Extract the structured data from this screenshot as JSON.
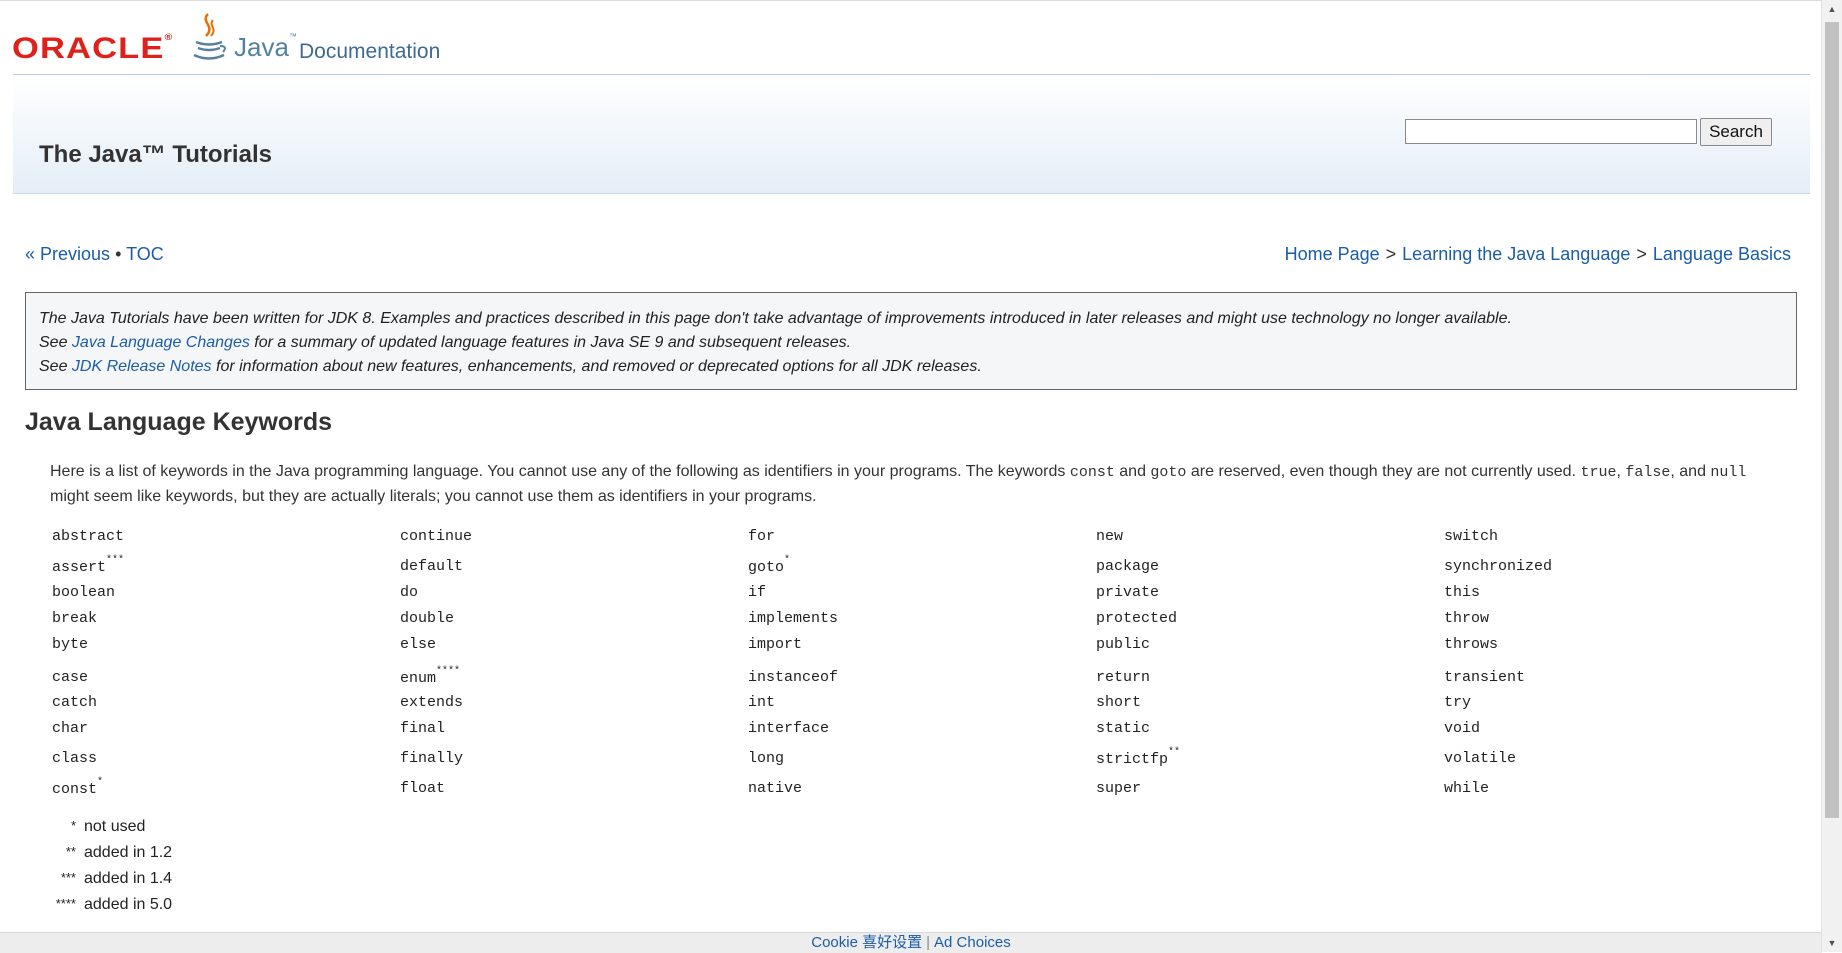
{
  "header": {
    "oracle_logo": "ORACLE",
    "java_logo": "Java",
    "doc_label": "Documentation"
  },
  "banner": {
    "title": "The Java™ Tutorials",
    "search_placeholder": "",
    "search_button": "Search"
  },
  "nav": {
    "previous": "« Previous",
    "bullet": "•",
    "toc": "TOC",
    "breadcrumb": [
      "Home Page",
      "Learning the Java Language",
      "Language Basics"
    ],
    "separator": ">"
  },
  "note": {
    "line1": "The Java Tutorials have been written for JDK 8. Examples and practices described in this page don't take advantage of improvements introduced in later releases and might use technology no longer available.",
    "line2_pre": "See ",
    "line2_link": "Java Language Changes",
    "line2_post": " for a summary of updated language features in Java SE 9 and subsequent releases.",
    "line3_pre": "See ",
    "line3_link": "JDK Release Notes",
    "line3_post": " for information about new features, enhancements, and removed or deprecated options for all JDK releases."
  },
  "section_title": "Java Language Keywords",
  "intro": {
    "p1": "Here is a list of keywords in the Java programming language. You cannot use any of the following as identifiers in your programs. The keywords ",
    "kw_const": "const",
    "and1": " and ",
    "kw_goto": "goto",
    "p2": " are reserved, even though they are not currently used. ",
    "kw_true": "true",
    "comma1": ", ",
    "kw_false": "false",
    "and2": ", and ",
    "kw_null": "null",
    "p3": " might seem like keywords, but they are actually literals; you cannot use them as identifiers in your programs."
  },
  "keywords": [
    [
      {
        "w": "abstract",
        "s": ""
      },
      {
        "w": "continue",
        "s": ""
      },
      {
        "w": "for",
        "s": ""
      },
      {
        "w": "new",
        "s": ""
      },
      {
        "w": "switch",
        "s": ""
      }
    ],
    [
      {
        "w": "assert",
        "s": "***"
      },
      {
        "w": "default",
        "s": ""
      },
      {
        "w": "goto",
        "s": "*"
      },
      {
        "w": "package",
        "s": ""
      },
      {
        "w": "synchronized",
        "s": ""
      }
    ],
    [
      {
        "w": "boolean",
        "s": ""
      },
      {
        "w": "do",
        "s": ""
      },
      {
        "w": "if",
        "s": ""
      },
      {
        "w": "private",
        "s": ""
      },
      {
        "w": "this",
        "s": ""
      }
    ],
    [
      {
        "w": "break",
        "s": ""
      },
      {
        "w": "double",
        "s": ""
      },
      {
        "w": "implements",
        "s": ""
      },
      {
        "w": "protected",
        "s": ""
      },
      {
        "w": "throw",
        "s": ""
      }
    ],
    [
      {
        "w": "byte",
        "s": ""
      },
      {
        "w": "else",
        "s": ""
      },
      {
        "w": "import",
        "s": ""
      },
      {
        "w": "public",
        "s": ""
      },
      {
        "w": "throws",
        "s": ""
      }
    ],
    [
      {
        "w": "case",
        "s": ""
      },
      {
        "w": "enum",
        "s": "****"
      },
      {
        "w": "instanceof",
        "s": ""
      },
      {
        "w": "return",
        "s": ""
      },
      {
        "w": "transient",
        "s": ""
      }
    ],
    [
      {
        "w": "catch",
        "s": ""
      },
      {
        "w": "extends",
        "s": ""
      },
      {
        "w": "int",
        "s": ""
      },
      {
        "w": "short",
        "s": ""
      },
      {
        "w": "try",
        "s": ""
      }
    ],
    [
      {
        "w": "char",
        "s": ""
      },
      {
        "w": "final",
        "s": ""
      },
      {
        "w": "interface",
        "s": ""
      },
      {
        "w": "static",
        "s": ""
      },
      {
        "w": "void",
        "s": ""
      }
    ],
    [
      {
        "w": "class",
        "s": ""
      },
      {
        "w": "finally",
        "s": ""
      },
      {
        "w": "long",
        "s": ""
      },
      {
        "w": "strictfp",
        "s": "**"
      },
      {
        "w": "volatile",
        "s": ""
      }
    ],
    [
      {
        "w": "const",
        "s": "*"
      },
      {
        "w": "float",
        "s": ""
      },
      {
        "w": "native",
        "s": ""
      },
      {
        "w": "super",
        "s": ""
      },
      {
        "w": "while",
        "s": ""
      }
    ]
  ],
  "legend": [
    {
      "mark": "*",
      "text": "not used"
    },
    {
      "mark": "**",
      "text": "added in 1.2"
    },
    {
      "mark": "***",
      "text": "added in 1.4"
    },
    {
      "mark": "****",
      "text": "added in 5.0"
    }
  ],
  "footer": {
    "cookie": "Cookie 喜好设置",
    "divider": "|",
    "ad_choices": "Ad Choices"
  }
}
